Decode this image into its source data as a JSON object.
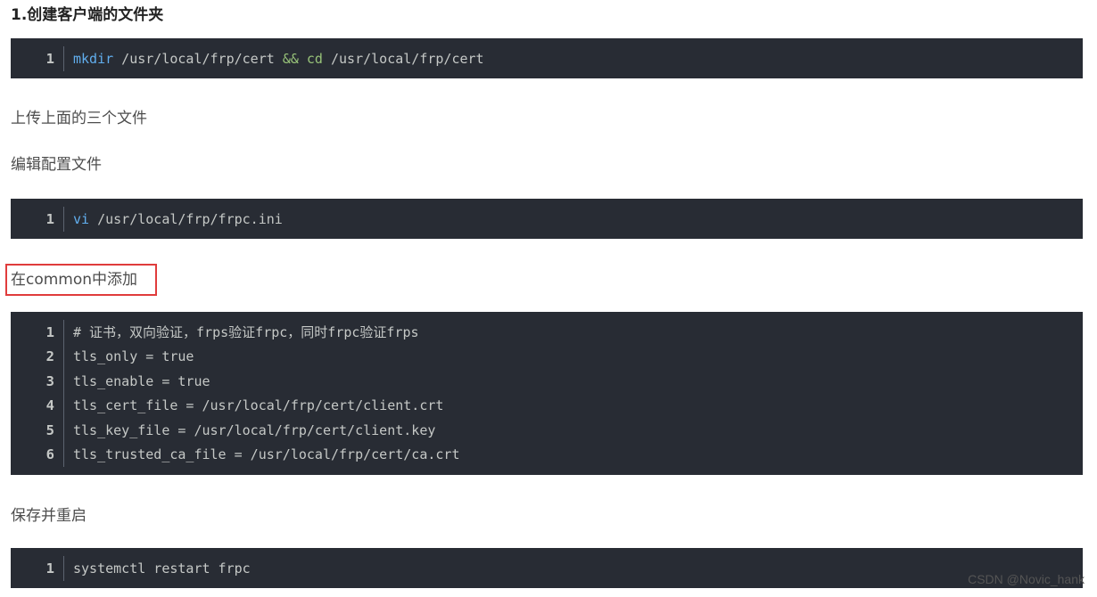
{
  "heading": "1.创建客户端的文件夹",
  "block1": {
    "line_no": "1",
    "cmd": "mkdir",
    "path1": " /usr/local/frp/cert ",
    "op": "&&",
    "sp": " ",
    "cmd2": "cd",
    "path2": " /usr/local/frp/cert"
  },
  "para_upload": "上传上面的三个文件",
  "para_edit": "编辑配置文件",
  "block2": {
    "line_no": "1",
    "cmd": "vi",
    "path": " /usr/local/frp/frpc.ini"
  },
  "para_common": "在common中添加",
  "block3": {
    "lines": [
      {
        "n": "1",
        "text": "# 证书，双向验证，frps验证frpc，同时frpc验证frps"
      },
      {
        "n": "2",
        "text": "tls_only = true"
      },
      {
        "n": "3",
        "text": "tls_enable = true"
      },
      {
        "n": "4",
        "text": "tls_cert_file = /usr/local/frp/cert/client.crt"
      },
      {
        "n": "5",
        "text": "tls_key_file = /usr/local/frp/cert/client.key"
      },
      {
        "n": "6",
        "text": "tls_trusted_ca_file = /usr/local/frp/cert/ca.crt"
      }
    ]
  },
  "para_save": "保存并重启",
  "block4": {
    "line_no": "1",
    "text": "systemctl restart frpc"
  },
  "watermark": "CSDN @Novic_hank"
}
